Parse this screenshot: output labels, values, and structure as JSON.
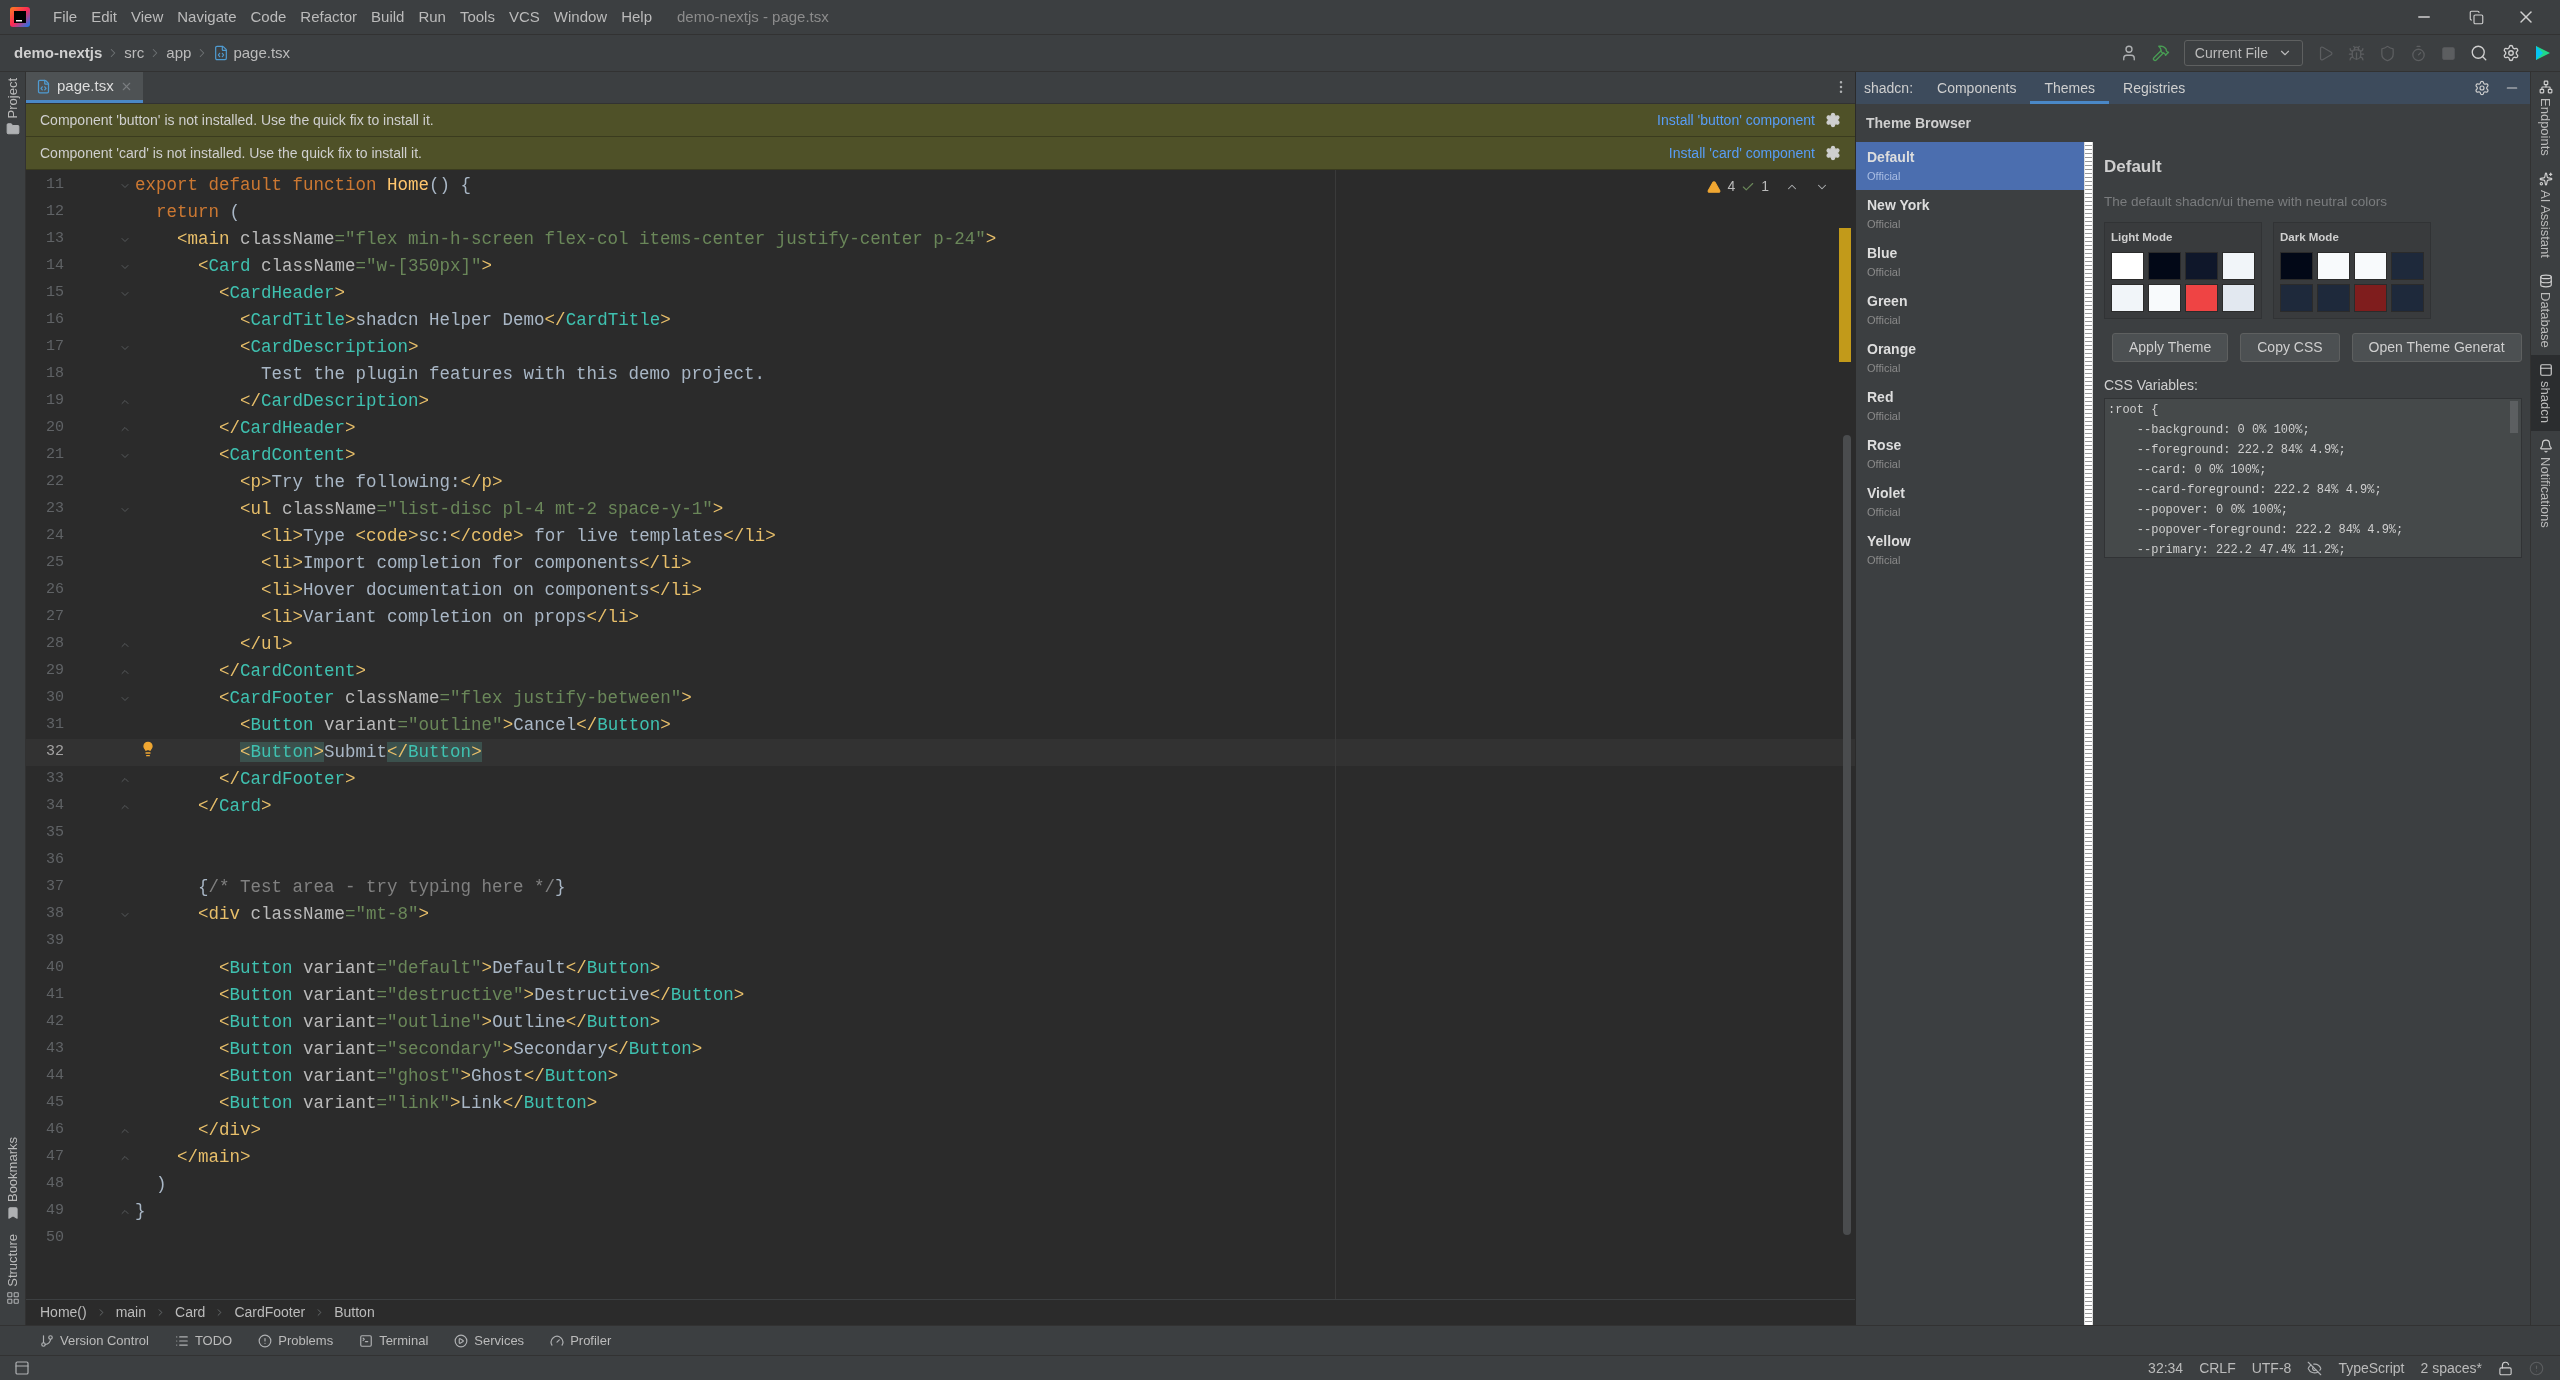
{
  "window": {
    "title": "demo-nextjs - page.tsx"
  },
  "menu": [
    "File",
    "Edit",
    "View",
    "Navigate",
    "Code",
    "Refactor",
    "Build",
    "Run",
    "Tools",
    "VCS",
    "Window",
    "Help"
  ],
  "navigation": {
    "path": [
      "demo-nextjs",
      "src",
      "app"
    ],
    "file": "page.tsx"
  },
  "toolbar": {
    "run_config": "Current File"
  },
  "left_tool_windows": [
    {
      "label": "Project",
      "kind": "top"
    },
    {
      "label": "Bookmarks",
      "kind": "bottom"
    },
    {
      "label": "Structure",
      "kind": "bottom"
    }
  ],
  "editor": {
    "tabs": [
      {
        "label": "page.tsx",
        "selected": true
      }
    ],
    "banners": [
      {
        "message": "Component 'button' is not installed. Use the quick fix to install it.",
        "action": "Install 'button' component"
      },
      {
        "message": "Component 'card' is not installed. Use the quick fix to install it.",
        "action": "Install 'card' component"
      }
    ],
    "inspections": {
      "warnings": "4",
      "weak_warnings": "1"
    },
    "lines": [
      {
        "number": "11",
        "current": false,
        "fold": {
          "kind": "open"
        },
        "tokens": [
          {
            "kind": "kw",
            "text": "export default function "
          },
          {
            "kind": "fn",
            "text": "Home"
          },
          {
            "kind": "text",
            "text": "() {"
          }
        ]
      },
      {
        "number": "12",
        "current": false,
        "tokens": [
          {
            "kind": "kw",
            "text": "  return"
          },
          {
            "kind": "text",
            "text": " ("
          }
        ]
      },
      {
        "number": "13",
        "current": false,
        "fold": {
          "kind": "open"
        },
        "tokens": [
          {
            "kind": "tag",
            "text": "    <main"
          },
          {
            "kind": "attr",
            "text": " className"
          },
          {
            "kind": "str",
            "text": "=\"flex min-h-screen flex-col items-center justify-center p-24\""
          },
          {
            "kind": "tag",
            "text": ">"
          }
        ]
      },
      {
        "number": "14",
        "current": false,
        "fold": {
          "kind": "open"
        },
        "tokens": [
          {
            "kind": "tag",
            "text": "      <"
          },
          {
            "kind": "comp",
            "text": "Card"
          },
          {
            "kind": "attr",
            "text": " className"
          },
          {
            "kind": "str",
            "text": "=\"w-[350px]\""
          },
          {
            "kind": "tag",
            "text": ">"
          }
        ]
      },
      {
        "number": "15",
        "current": false,
        "fold": {
          "kind": "open"
        },
        "tokens": [
          {
            "kind": "tag",
            "text": "        <"
          },
          {
            "kind": "comp",
            "text": "CardHeader"
          },
          {
            "kind": "tag",
            "text": ">"
          }
        ]
      },
      {
        "number": "16",
        "current": false,
        "tokens": [
          {
            "kind": "tag",
            "text": "          <"
          },
          {
            "kind": "comp",
            "text": "CardTitle"
          },
          {
            "kind": "tag",
            "text": ">"
          },
          {
            "kind": "text",
            "text": "shadcn Helper Demo"
          },
          {
            "kind": "tag",
            "text": "</"
          },
          {
            "kind": "comp",
            "text": "CardTitle"
          },
          {
            "kind": "tag",
            "text": ">"
          }
        ]
      },
      {
        "number": "17",
        "current": false,
        "fold": {
          "kind": "open"
        },
        "tokens": [
          {
            "kind": "tag",
            "text": "          <"
          },
          {
            "kind": "comp",
            "text": "CardDescription"
          },
          {
            "kind": "tag",
            "text": ">"
          }
        ]
      },
      {
        "number": "18",
        "current": false,
        "tokens": [
          {
            "kind": "text",
            "text": "            Test the plugin features with this demo project."
          }
        ]
      },
      {
        "number": "19",
        "current": false,
        "fold": {
          "kind": "close"
        },
        "tokens": [
          {
            "kind": "tag",
            "text": "          </"
          },
          {
            "kind": "comp",
            "text": "CardDescription"
          },
          {
            "kind": "tag",
            "text": ">"
          }
        ]
      },
      {
        "number": "20",
        "current": false,
        "fold": {
          "kind": "close"
        },
        "tokens": [
          {
            "kind": "tag",
            "text": "        </"
          },
          {
            "kind": "comp",
            "text": "CardHeader"
          },
          {
            "kind": "tag",
            "text": ">"
          }
        ]
      },
      {
        "number": "21",
        "current": false,
        "fold": {
          "kind": "open"
        },
        "tokens": [
          {
            "kind": "tag",
            "text": "        <"
          },
          {
            "kind": "comp",
            "text": "CardContent"
          },
          {
            "kind": "tag",
            "text": ">"
          }
        ]
      },
      {
        "number": "22",
        "current": false,
        "tokens": [
          {
            "kind": "tag",
            "text": "          <p>"
          },
          {
            "kind": "text",
            "text": "Try the following:"
          },
          {
            "kind": "tag",
            "text": "</p>"
          }
        ]
      },
      {
        "number": "23",
        "current": false,
        "fold": {
          "kind": "open"
        },
        "tokens": [
          {
            "kind": "tag",
            "text": "          <ul"
          },
          {
            "kind": "attr",
            "text": " className"
          },
          {
            "kind": "str",
            "text": "=\"list-disc pl-4 mt-2 space-y-1\""
          },
          {
            "kind": "tag",
            "text": ">"
          }
        ]
      },
      {
        "number": "24",
        "current": false,
        "tokens": [
          {
            "kind": "tag",
            "text": "            <li>"
          },
          {
            "kind": "text",
            "text": "Type "
          },
          {
            "kind": "tag",
            "text": "<code>"
          },
          {
            "kind": "text",
            "text": "sc:"
          },
          {
            "kind": "tag",
            "text": "</code>"
          },
          {
            "kind": "text",
            "text": " for live templates"
          },
          {
            "kind": "tag",
            "text": "</li>"
          }
        ]
      },
      {
        "number": "25",
        "current": false,
        "tokens": [
          {
            "kind": "tag",
            "text": "            <li>"
          },
          {
            "kind": "text",
            "text": "Import completion for components"
          },
          {
            "kind": "tag",
            "text": "</li>"
          }
        ]
      },
      {
        "number": "26",
        "current": false,
        "tokens": [
          {
            "kind": "tag",
            "text": "            <li>"
          },
          {
            "kind": "text",
            "text": "Hover documentation on components"
          },
          {
            "kind": "tag",
            "text": "</li>"
          }
        ]
      },
      {
        "number": "27",
        "current": false,
        "tokens": [
          {
            "kind": "tag",
            "text": "            <li>"
          },
          {
            "kind": "text",
            "text": "Variant completion on props"
          },
          {
            "kind": "tag",
            "text": "</li>"
          }
        ]
      },
      {
        "number": "28",
        "current": false,
        "fold": {
          "kind": "close"
        },
        "tokens": [
          {
            "kind": "tag",
            "text": "          </ul>"
          }
        ]
      },
      {
        "number": "29",
        "current": false,
        "fold": {
          "kind": "close"
        },
        "tokens": [
          {
            "kind": "tag",
            "text": "        </"
          },
          {
            "kind": "comp",
            "text": "CardContent"
          },
          {
            "kind": "tag",
            "text": ">"
          }
        ]
      },
      {
        "number": "30",
        "current": false,
        "fold": {
          "kind": "open"
        },
        "tokens": [
          {
            "kind": "tag",
            "text": "        <"
          },
          {
            "kind": "comp",
            "text": "CardFooter"
          },
          {
            "kind": "attr",
            "text": " className"
          },
          {
            "kind": "str",
            "text": "=\"flex justify-between\""
          },
          {
            "kind": "tag",
            "text": ">"
          }
        ]
      },
      {
        "number": "31",
        "current": false,
        "tokens": [
          {
            "kind": "tag",
            "text": "          <"
          },
          {
            "kind": "comp",
            "text": "Button"
          },
          {
            "kind": "attr",
            "text": " variant"
          },
          {
            "kind": "str",
            "text": "=\"outline\""
          },
          {
            "kind": "tag",
            "text": ">"
          },
          {
            "kind": "text",
            "text": "Cancel"
          },
          {
            "kind": "tag",
            "text": "</"
          },
          {
            "kind": "comp",
            "text": "Button"
          },
          {
            "kind": "tag",
            "text": ">"
          }
        ]
      },
      {
        "number": "32",
        "current": true,
        "tokens": [
          {
            "kind": "mtag",
            "text": "          <"
          },
          {
            "kind": "mcomp",
            "text": "Button"
          },
          {
            "kind": "mtag",
            "text": ">"
          },
          {
            "kind": "text",
            "text": "Submit"
          },
          {
            "kind": "mtag",
            "text": "</"
          },
          {
            "kind": "mcomp",
            "text": "Button"
          },
          {
            "kind": "mtag",
            "text": ">"
          }
        ]
      },
      {
        "number": "33",
        "current": false,
        "fold": {
          "kind": "close"
        },
        "tokens": [
          {
            "kind": "tag",
            "text": "        </"
          },
          {
            "kind": "comp",
            "text": "CardFooter"
          },
          {
            "kind": "tag",
            "text": ">"
          }
        ]
      },
      {
        "number": "34",
        "current": false,
        "fold": {
          "kind": "close"
        },
        "tokens": [
          {
            "kind": "tag",
            "text": "      </"
          },
          {
            "kind": "comp",
            "text": "Card"
          },
          {
            "kind": "tag",
            "text": ">"
          }
        ]
      },
      {
        "number": "35",
        "current": false
      },
      {
        "number": "36",
        "current": false
      },
      {
        "number": "37",
        "current": false,
        "tokens": [
          {
            "kind": "text",
            "text": "      {"
          },
          {
            "kind": "comment",
            "text": "/* Test area - try typing here */"
          },
          {
            "kind": "text",
            "text": "}"
          }
        ]
      },
      {
        "number": "38",
        "current": false,
        "fold": {
          "kind": "open"
        },
        "tokens": [
          {
            "kind": "tag",
            "text": "      <div"
          },
          {
            "kind": "attr",
            "text": " className"
          },
          {
            "kind": "str",
            "text": "=\"mt-8\""
          },
          {
            "kind": "tag",
            "text": ">"
          }
        ]
      },
      {
        "number": "39",
        "current": false
      },
      {
        "number": "40",
        "current": false,
        "tokens": [
          {
            "kind": "tag",
            "text": "        <"
          },
          {
            "kind": "comp",
            "text": "Button"
          },
          {
            "kind": "attr",
            "text": " variant"
          },
          {
            "kind": "str",
            "text": "=\"default\""
          },
          {
            "kind": "tag",
            "text": ">"
          },
          {
            "kind": "text",
            "text": "Default"
          },
          {
            "kind": "tag",
            "text": "</"
          },
          {
            "kind": "comp",
            "text": "Button"
          },
          {
            "kind": "tag",
            "text": ">"
          }
        ]
      },
      {
        "number": "41",
        "current": false,
        "tokens": [
          {
            "kind": "tag",
            "text": "        <"
          },
          {
            "kind": "comp",
            "text": "Button"
          },
          {
            "kind": "attr",
            "text": " variant"
          },
          {
            "kind": "str",
            "text": "=\"destructive\""
          },
          {
            "kind": "tag",
            "text": ">"
          },
          {
            "kind": "text",
            "text": "Destructive"
          },
          {
            "kind": "tag",
            "text": "</"
          },
          {
            "kind": "comp",
            "text": "Button"
          },
          {
            "kind": "tag",
            "text": ">"
          }
        ]
      },
      {
        "number": "42",
        "current": false,
        "tokens": [
          {
            "kind": "tag",
            "text": "        <"
          },
          {
            "kind": "comp",
            "text": "Button"
          },
          {
            "kind": "attr",
            "text": " variant"
          },
          {
            "kind": "str",
            "text": "=\"outline\""
          },
          {
            "kind": "tag",
            "text": ">"
          },
          {
            "kind": "text",
            "text": "Outline"
          },
          {
            "kind": "tag",
            "text": "</"
          },
          {
            "kind": "comp",
            "text": "Button"
          },
          {
            "kind": "tag",
            "text": ">"
          }
        ]
      },
      {
        "number": "43",
        "current": false,
        "tokens": [
          {
            "kind": "tag",
            "text": "        <"
          },
          {
            "kind": "comp",
            "text": "Button"
          },
          {
            "kind": "attr",
            "text": " variant"
          },
          {
            "kind": "str",
            "text": "=\"secondary\""
          },
          {
            "kind": "tag",
            "text": ">"
          },
          {
            "kind": "text",
            "text": "Secondary"
          },
          {
            "kind": "tag",
            "text": "</"
          },
          {
            "kind": "comp",
            "text": "Button"
          },
          {
            "kind": "tag",
            "text": ">"
          }
        ]
      },
      {
        "number": "44",
        "current": false,
        "tokens": [
          {
            "kind": "tag",
            "text": "        <"
          },
          {
            "kind": "comp",
            "text": "Button"
          },
          {
            "kind": "attr",
            "text": " variant"
          },
          {
            "kind": "str",
            "text": "=\"ghost\""
          },
          {
            "kind": "tag",
            "text": ">"
          },
          {
            "kind": "text",
            "text": "Ghost"
          },
          {
            "kind": "tag",
            "text": "</"
          },
          {
            "kind": "comp",
            "text": "Button"
          },
          {
            "kind": "tag",
            "text": ">"
          }
        ]
      },
      {
        "number": "45",
        "current": false,
        "tokens": [
          {
            "kind": "tag",
            "text": "        <"
          },
          {
            "kind": "comp",
            "text": "Button"
          },
          {
            "kind": "attr",
            "text": " variant"
          },
          {
            "kind": "str",
            "text": "=\"link\""
          },
          {
            "kind": "tag",
            "text": ">"
          },
          {
            "kind": "text",
            "text": "Link"
          },
          {
            "kind": "tag",
            "text": "</"
          },
          {
            "kind": "comp",
            "text": "Button"
          },
          {
            "kind": "tag",
            "text": ">"
          }
        ]
      },
      {
        "number": "46",
        "current": false,
        "fold": {
          "kind": "close"
        },
        "tokens": [
          {
            "kind": "tag",
            "text": "      </div>"
          }
        ]
      },
      {
        "number": "47",
        "current": false,
        "fold": {
          "kind": "close"
        },
        "tokens": [
          {
            "kind": "tag",
            "text": "    </main>"
          }
        ]
      },
      {
        "number": "48",
        "current": false,
        "tokens": [
          {
            "kind": "text",
            "text": "  )"
          }
        ]
      },
      {
        "number": "49",
        "current": false,
        "fold": {
          "kind": "close"
        },
        "tokens": [
          {
            "kind": "text",
            "text": "}"
          }
        ]
      },
      {
        "number": "50",
        "current": false
      }
    ],
    "breadcrumb": [
      "Home()",
      "main",
      "Card",
      "CardFooter",
      "Button"
    ]
  },
  "shadcn_panel": {
    "label": "shadcn:",
    "tabs": [
      {
        "label": "Components",
        "selected": false
      },
      {
        "label": "Themes",
        "selected": true
      },
      {
        "label": "Registries",
        "selected": false
      }
    ],
    "browser_title": "Theme Browser",
    "themes": [
      {
        "name": "Default",
        "source": "Official",
        "selected": true
      },
      {
        "name": "New York",
        "source": "Official",
        "selected": false
      },
      {
        "name": "Blue",
        "source": "Official",
        "selected": false
      },
      {
        "name": "Green",
        "source": "Official",
        "selected": false
      },
      {
        "name": "Orange",
        "source": "Official",
        "selected": false
      },
      {
        "name": "Red",
        "source": "Official",
        "selected": false
      },
      {
        "name": "Rose",
        "source": "Official",
        "selected": false
      },
      {
        "name": "Violet",
        "source": "Official",
        "selected": false
      },
      {
        "name": "Yellow",
        "source": "Official",
        "selected": false
      }
    ],
    "detail": {
      "title": "Default",
      "description": "The default shadcn/ui theme with neutral colors",
      "palettes": [
        {
          "label": "Light Mode",
          "swatches": [
            {
              "color": "#ffffff"
            },
            {
              "color": "#020817"
            },
            {
              "color": "#0f172a"
            },
            {
              "color": "#f1f5f9"
            },
            {
              "color": "#f1f5f9"
            },
            {
              "color": "#f8fafc"
            },
            {
              "color": "#ef4444"
            },
            {
              "color": "#e2e8f0"
            }
          ]
        },
        {
          "label": "Dark Mode",
          "swatches": [
            {
              "color": "#020817"
            },
            {
              "color": "#f8fafc"
            },
            {
              "color": "#f8fafc"
            },
            {
              "color": "#1e293b"
            },
            {
              "color": "#1e293b"
            },
            {
              "color": "#1e293b"
            },
            {
              "color": "#7f1d1d"
            },
            {
              "color": "#1e293b"
            }
          ]
        }
      ],
      "buttons": [
        "Apply Theme",
        "Copy CSS",
        "Open Theme Generat"
      ],
      "css_label": "CSS Variables:",
      "css_lines": [
        ":root {",
        "    --background: 0 0% 100%;",
        "    --foreground: 222.2 84% 4.9%;",
        "    --card: 0 0% 100%;",
        "    --card-foreground: 222.2 84% 4.9%;",
        "    --popover: 0 0% 100%;",
        "    --popover-foreground: 222.2 84% 4.9%;",
        "    --primary: 222.2 47.4% 11.2%;"
      ]
    }
  },
  "right_tool_windows": [
    {
      "label": "Endpoints",
      "kind": "endpoints",
      "selected": false
    },
    {
      "label": "AI Assistant",
      "kind": "ai",
      "selected": false
    },
    {
      "label": "Database",
      "kind": "database",
      "selected": false
    },
    {
      "label": "shadcn",
      "kind": "shadcn",
      "selected": true
    },
    {
      "label": "Notifications",
      "kind": "notifications",
      "selected": false
    }
  ],
  "bottom_tool_windows": [
    {
      "label": "Version Control",
      "kind": "vcs"
    },
    {
      "label": "TODO",
      "kind": "todo"
    },
    {
      "label": "Problems",
      "kind": "problems"
    },
    {
      "label": "Terminal",
      "kind": "terminal"
    },
    {
      "label": "Services",
      "kind": "services"
    },
    {
      "label": "Profiler",
      "kind": "profiler"
    }
  ],
  "status_bar": {
    "position": "32:34",
    "line_separator": "CRLF",
    "encoding": "UTF-8",
    "language": "TypeScript",
    "indent": "2 spaces*"
  }
}
